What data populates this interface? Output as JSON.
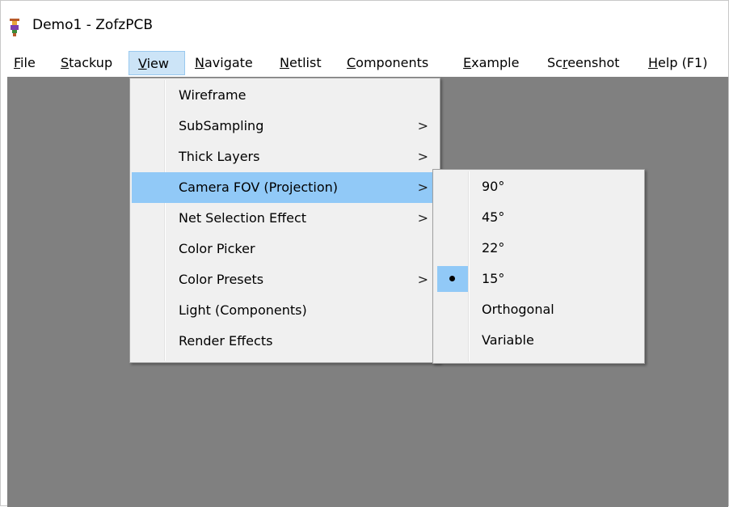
{
  "window": {
    "title": "Demo1 - ZofzPCB",
    "icon": "app-icon",
    "icon_colors": [
      "#b85a2a",
      "#e8a63a",
      "#7a3fb0",
      "#3a8a3a"
    ]
  },
  "menubar": {
    "items": [
      {
        "label": "File",
        "underline": "F",
        "rest": "ile"
      },
      {
        "label": "Stackup",
        "underline": "S",
        "rest": "tackup"
      },
      {
        "label": "View",
        "underline": "V",
        "rest": "iew"
      },
      {
        "label": "Navigate",
        "underline": "N",
        "rest": "avigate"
      },
      {
        "label": "Netlist",
        "underline": "N",
        "rest": "etlist"
      },
      {
        "label": "Components",
        "underline": "C",
        "rest": "omponents"
      },
      {
        "label": "Example",
        "underline": "E",
        "rest": "xample"
      },
      {
        "label": "Screenshot",
        "pre": "Sc",
        "underline": "r",
        "rest": "eenshot"
      },
      {
        "label": "Help (F1)",
        "underline": "H",
        "rest": "elp (F1)"
      }
    ],
    "open_item": "View"
  },
  "view_menu": {
    "items": [
      {
        "label": "Wireframe",
        "submenu": false
      },
      {
        "label": "SubSampling",
        "submenu": true
      },
      {
        "label": "Thick Layers",
        "submenu": true
      },
      {
        "label": "Camera FOV (Projection)",
        "submenu": true,
        "highlighted": true
      },
      {
        "label": "Net Selection Effect",
        "submenu": true
      },
      {
        "label": "Color Picker",
        "submenu": false
      },
      {
        "label": "Color Presets",
        "submenu": true
      },
      {
        "label": "Light (Components)",
        "submenu": false
      },
      {
        "label": "Render Effects",
        "submenu": false
      }
    ],
    "arrow": ">"
  },
  "fov_submenu": {
    "items": [
      {
        "label": "90°",
        "checked": false
      },
      {
        "label": "45°",
        "checked": false
      },
      {
        "label": "22°",
        "checked": false
      },
      {
        "label": "15°",
        "checked": true
      },
      {
        "label": "Orthogonal",
        "checked": false
      },
      {
        "label": "Variable",
        "checked": false
      }
    ]
  },
  "colors": {
    "canvas": "#808080",
    "menu_bg": "#f0f0f0",
    "highlight": "#91c9f7",
    "menubar_open": "#cce4f7"
  }
}
